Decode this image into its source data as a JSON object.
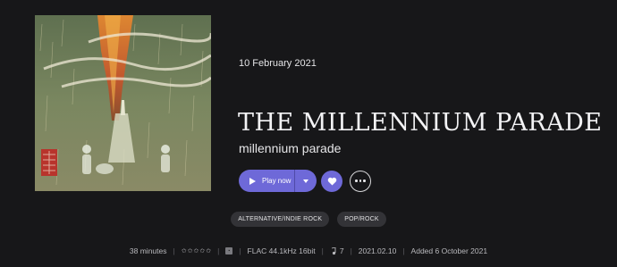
{
  "album": {
    "cover_icon": "album-cover-art",
    "release_date": "10 February 2021",
    "title": "THE MILLENNIUM PARADE",
    "artist": "millennium parade"
  },
  "actions": {
    "play_label": "Play now",
    "play_icon": "play-icon",
    "dropdown_icon": "chevron-down-icon",
    "favorite_icon": "heart-icon",
    "more_icon": "more-icon",
    "accent_color": "#6e69d8"
  },
  "genres": [
    "ALTERNATIVE/INDIE ROCK",
    "POP/ROCK"
  ],
  "meta": {
    "duration": "38 minutes",
    "rating_stars": 0,
    "rating_max": 5,
    "quality_icon": "quality-badge-icon",
    "format": "FLAC 44.1kHz 16bit",
    "tracks_label": "7",
    "version": "2021.02.10",
    "added": "Added 6 October 2021"
  }
}
